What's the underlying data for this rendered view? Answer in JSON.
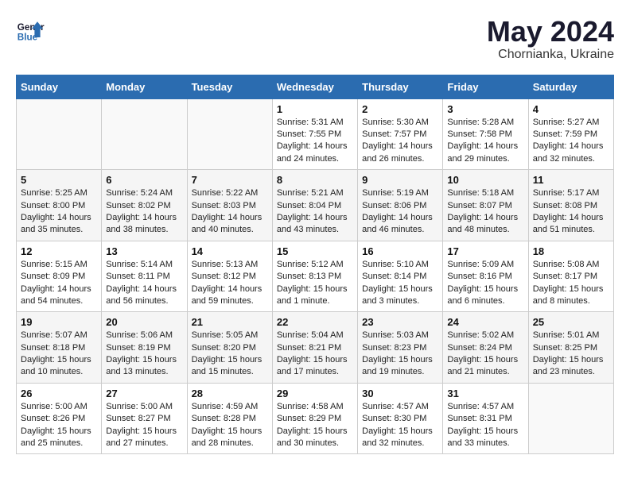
{
  "header": {
    "logo_line1": "General",
    "logo_line2": "Blue",
    "month": "May 2024",
    "location": "Chornianka, Ukraine"
  },
  "weekdays": [
    "Sunday",
    "Monday",
    "Tuesday",
    "Wednesday",
    "Thursday",
    "Friday",
    "Saturday"
  ],
  "weeks": [
    [
      {
        "day": "",
        "sunrise": "",
        "sunset": "",
        "daylight": ""
      },
      {
        "day": "",
        "sunrise": "",
        "sunset": "",
        "daylight": ""
      },
      {
        "day": "",
        "sunrise": "",
        "sunset": "",
        "daylight": ""
      },
      {
        "day": "1",
        "sunrise": "Sunrise: 5:31 AM",
        "sunset": "Sunset: 7:55 PM",
        "daylight": "Daylight: 14 hours and 24 minutes."
      },
      {
        "day": "2",
        "sunrise": "Sunrise: 5:30 AM",
        "sunset": "Sunset: 7:57 PM",
        "daylight": "Daylight: 14 hours and 26 minutes."
      },
      {
        "day": "3",
        "sunrise": "Sunrise: 5:28 AM",
        "sunset": "Sunset: 7:58 PM",
        "daylight": "Daylight: 14 hours and 29 minutes."
      },
      {
        "day": "4",
        "sunrise": "Sunrise: 5:27 AM",
        "sunset": "Sunset: 7:59 PM",
        "daylight": "Daylight: 14 hours and 32 minutes."
      }
    ],
    [
      {
        "day": "5",
        "sunrise": "Sunrise: 5:25 AM",
        "sunset": "Sunset: 8:00 PM",
        "daylight": "Daylight: 14 hours and 35 minutes."
      },
      {
        "day": "6",
        "sunrise": "Sunrise: 5:24 AM",
        "sunset": "Sunset: 8:02 PM",
        "daylight": "Daylight: 14 hours and 38 minutes."
      },
      {
        "day": "7",
        "sunrise": "Sunrise: 5:22 AM",
        "sunset": "Sunset: 8:03 PM",
        "daylight": "Daylight: 14 hours and 40 minutes."
      },
      {
        "day": "8",
        "sunrise": "Sunrise: 5:21 AM",
        "sunset": "Sunset: 8:04 PM",
        "daylight": "Daylight: 14 hours and 43 minutes."
      },
      {
        "day": "9",
        "sunrise": "Sunrise: 5:19 AM",
        "sunset": "Sunset: 8:06 PM",
        "daylight": "Daylight: 14 hours and 46 minutes."
      },
      {
        "day": "10",
        "sunrise": "Sunrise: 5:18 AM",
        "sunset": "Sunset: 8:07 PM",
        "daylight": "Daylight: 14 hours and 48 minutes."
      },
      {
        "day": "11",
        "sunrise": "Sunrise: 5:17 AM",
        "sunset": "Sunset: 8:08 PM",
        "daylight": "Daylight: 14 hours and 51 minutes."
      }
    ],
    [
      {
        "day": "12",
        "sunrise": "Sunrise: 5:15 AM",
        "sunset": "Sunset: 8:09 PM",
        "daylight": "Daylight: 14 hours and 54 minutes."
      },
      {
        "day": "13",
        "sunrise": "Sunrise: 5:14 AM",
        "sunset": "Sunset: 8:11 PM",
        "daylight": "Daylight: 14 hours and 56 minutes."
      },
      {
        "day": "14",
        "sunrise": "Sunrise: 5:13 AM",
        "sunset": "Sunset: 8:12 PM",
        "daylight": "Daylight: 14 hours and 59 minutes."
      },
      {
        "day": "15",
        "sunrise": "Sunrise: 5:12 AM",
        "sunset": "Sunset: 8:13 PM",
        "daylight": "Daylight: 15 hours and 1 minute."
      },
      {
        "day": "16",
        "sunrise": "Sunrise: 5:10 AM",
        "sunset": "Sunset: 8:14 PM",
        "daylight": "Daylight: 15 hours and 3 minutes."
      },
      {
        "day": "17",
        "sunrise": "Sunrise: 5:09 AM",
        "sunset": "Sunset: 8:16 PM",
        "daylight": "Daylight: 15 hours and 6 minutes."
      },
      {
        "day": "18",
        "sunrise": "Sunrise: 5:08 AM",
        "sunset": "Sunset: 8:17 PM",
        "daylight": "Daylight: 15 hours and 8 minutes."
      }
    ],
    [
      {
        "day": "19",
        "sunrise": "Sunrise: 5:07 AM",
        "sunset": "Sunset: 8:18 PM",
        "daylight": "Daylight: 15 hours and 10 minutes."
      },
      {
        "day": "20",
        "sunrise": "Sunrise: 5:06 AM",
        "sunset": "Sunset: 8:19 PM",
        "daylight": "Daylight: 15 hours and 13 minutes."
      },
      {
        "day": "21",
        "sunrise": "Sunrise: 5:05 AM",
        "sunset": "Sunset: 8:20 PM",
        "daylight": "Daylight: 15 hours and 15 minutes."
      },
      {
        "day": "22",
        "sunrise": "Sunrise: 5:04 AM",
        "sunset": "Sunset: 8:21 PM",
        "daylight": "Daylight: 15 hours and 17 minutes."
      },
      {
        "day": "23",
        "sunrise": "Sunrise: 5:03 AM",
        "sunset": "Sunset: 8:23 PM",
        "daylight": "Daylight: 15 hours and 19 minutes."
      },
      {
        "day": "24",
        "sunrise": "Sunrise: 5:02 AM",
        "sunset": "Sunset: 8:24 PM",
        "daylight": "Daylight: 15 hours and 21 minutes."
      },
      {
        "day": "25",
        "sunrise": "Sunrise: 5:01 AM",
        "sunset": "Sunset: 8:25 PM",
        "daylight": "Daylight: 15 hours and 23 minutes."
      }
    ],
    [
      {
        "day": "26",
        "sunrise": "Sunrise: 5:00 AM",
        "sunset": "Sunset: 8:26 PM",
        "daylight": "Daylight: 15 hours and 25 minutes."
      },
      {
        "day": "27",
        "sunrise": "Sunrise: 5:00 AM",
        "sunset": "Sunset: 8:27 PM",
        "daylight": "Daylight: 15 hours and 27 minutes."
      },
      {
        "day": "28",
        "sunrise": "Sunrise: 4:59 AM",
        "sunset": "Sunset: 8:28 PM",
        "daylight": "Daylight: 15 hours and 28 minutes."
      },
      {
        "day": "29",
        "sunrise": "Sunrise: 4:58 AM",
        "sunset": "Sunset: 8:29 PM",
        "daylight": "Daylight: 15 hours and 30 minutes."
      },
      {
        "day": "30",
        "sunrise": "Sunrise: 4:57 AM",
        "sunset": "Sunset: 8:30 PM",
        "daylight": "Daylight: 15 hours and 32 minutes."
      },
      {
        "day": "31",
        "sunrise": "Sunrise: 4:57 AM",
        "sunset": "Sunset: 8:31 PM",
        "daylight": "Daylight: 15 hours and 33 minutes."
      },
      {
        "day": "",
        "sunrise": "",
        "sunset": "",
        "daylight": ""
      }
    ]
  ]
}
